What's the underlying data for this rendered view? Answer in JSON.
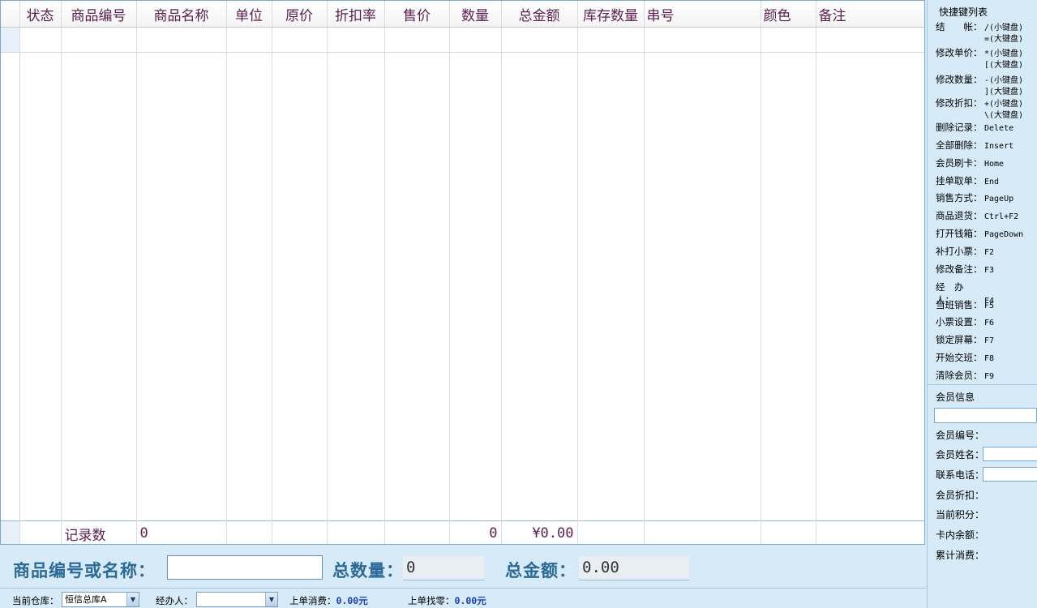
{
  "grid": {
    "columns": [
      "状态",
      "商品编号",
      "商品名称",
      "单位",
      "原价",
      "折扣率",
      "售价",
      "数量",
      "总金额",
      "库存数量",
      "串号",
      "颜色",
      "备注"
    ],
    "footer": {
      "record_label": "记录数",
      "record_count": "0",
      "quantity_total": "0",
      "amount_total": "¥0.00"
    }
  },
  "shortcuts": {
    "title": "快捷键列表",
    "items": [
      {
        "label": "结　　帐：",
        "key": "/(小键盘)",
        "key2": "=(大键盘)"
      },
      {
        "label": "修改单价：",
        "key": "*(小键盘)",
        "key2": "[(大键盘)"
      },
      {
        "label": "修改数量：",
        "key": "-(小键盘)",
        "key2": "](大键盘)"
      },
      {
        "label": "修改折扣：",
        "key": "+(小键盘)",
        "key2": "\\(大键盘)"
      },
      {
        "label": "删除记录：",
        "key": "Delete"
      },
      {
        "label": "全部删除：",
        "key": "Insert"
      },
      {
        "label": "会员刷卡：",
        "key": "Home"
      },
      {
        "label": "挂单取单：",
        "key": "End"
      },
      {
        "label": "销售方式：",
        "key": "PageUp"
      },
      {
        "label": "商品退货：",
        "key": "Ctrl+F2"
      },
      {
        "label": "打开钱箱：",
        "key": "PageDown"
      },
      {
        "label": "补打小票：",
        "key": "F2"
      },
      {
        "label": "修改备注：",
        "key": "F3"
      },
      {
        "label": "经　办　人：",
        "key": "F4"
      },
      {
        "label": "当班销售：",
        "key": "F5"
      },
      {
        "label": "小票设置：",
        "key": "F6"
      },
      {
        "label": "锁定屏幕：",
        "key": "F7"
      },
      {
        "label": "开始交班：",
        "key": "F8"
      },
      {
        "label": "清除会员：",
        "key": "F9"
      }
    ]
  },
  "member": {
    "title": "会员信息",
    "card_input_value": "",
    "id_label": "会员编号：",
    "name_label": "会员姓名：",
    "phone_label": "联系电话：",
    "discount_label": "会员折扣：",
    "points_label": "当前积分：",
    "balance_label": "卡内余额：",
    "total_label": "累计消费："
  },
  "bottom": {
    "code_label": "商品编号或名称：",
    "code_value": "",
    "qty_label": "总数量：",
    "qty_value": "0",
    "amount_label": "总金额：",
    "amount_value": "0.00",
    "warehouse_label": "当前仓库：",
    "warehouse_value": "恒信总库A",
    "handler_label": "经办人：",
    "handler_value": "",
    "last_spend_label": "上单消费：",
    "last_spend_value": "0.00元",
    "last_change_label": "上单找零：",
    "last_change_value": "0.00元"
  }
}
